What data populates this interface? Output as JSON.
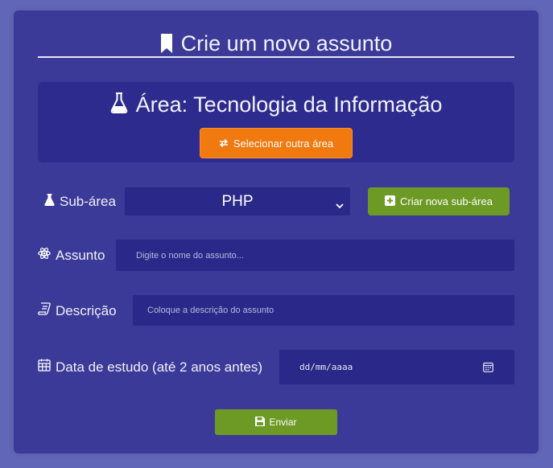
{
  "form": {
    "title": "Crie um novo assunto",
    "area_title": "Área: Tecnologia da Informação",
    "change_area_button": "Selecionar outra área",
    "subarea_label": "Sub-área",
    "subarea_selected": "PHP",
    "create_subarea_button": "Criar nova sub-área",
    "subject_label": "Assunto",
    "subject_placeholder": "Digite o nome do assunto...",
    "description_label": "Descrição",
    "description_placeholder": "Coloque a descrição do assunto",
    "date_label": "Data de estudo (até 2 anos antes)",
    "date_placeholder": "dd/mm/aaaa",
    "submit_button": "Enviar"
  },
  "colors": {
    "background": "#6266b8",
    "card": "#3c3a98",
    "field": "#2a2888",
    "accent_orange": "#f07a10",
    "accent_green": "#6c9a25"
  },
  "icons": [
    "bookmark-icon",
    "flask-icon",
    "swap-icon",
    "flask-small-icon",
    "plus-square-icon",
    "atom-icon",
    "scroll-icon",
    "calendar-icon",
    "save-icon",
    "chevron-down-icon"
  ]
}
